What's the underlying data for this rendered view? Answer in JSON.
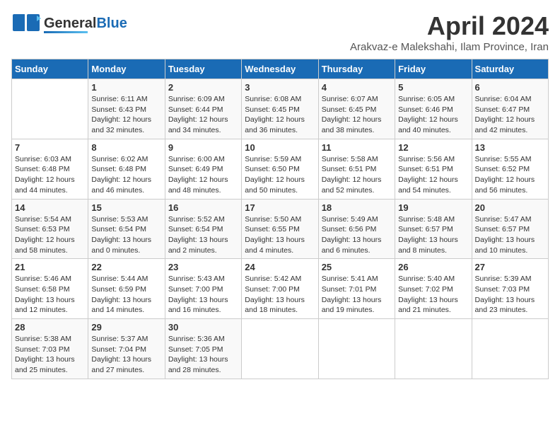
{
  "header": {
    "logo_general": "General",
    "logo_blue": "Blue",
    "month": "April 2024",
    "location": "Arakvaz-e Malekshahi, Ilam Province, Iran"
  },
  "days_of_week": [
    "Sunday",
    "Monday",
    "Tuesday",
    "Wednesday",
    "Thursday",
    "Friday",
    "Saturday"
  ],
  "weeks": [
    [
      {
        "day": "",
        "info": ""
      },
      {
        "day": "1",
        "info": "Sunrise: 6:11 AM\nSunset: 6:43 PM\nDaylight: 12 hours\nand 32 minutes."
      },
      {
        "day": "2",
        "info": "Sunrise: 6:09 AM\nSunset: 6:44 PM\nDaylight: 12 hours\nand 34 minutes."
      },
      {
        "day": "3",
        "info": "Sunrise: 6:08 AM\nSunset: 6:45 PM\nDaylight: 12 hours\nand 36 minutes."
      },
      {
        "day": "4",
        "info": "Sunrise: 6:07 AM\nSunset: 6:45 PM\nDaylight: 12 hours\nand 38 minutes."
      },
      {
        "day": "5",
        "info": "Sunrise: 6:05 AM\nSunset: 6:46 PM\nDaylight: 12 hours\nand 40 minutes."
      },
      {
        "day": "6",
        "info": "Sunrise: 6:04 AM\nSunset: 6:47 PM\nDaylight: 12 hours\nand 42 minutes."
      }
    ],
    [
      {
        "day": "7",
        "info": "Sunrise: 6:03 AM\nSunset: 6:48 PM\nDaylight: 12 hours\nand 44 minutes."
      },
      {
        "day": "8",
        "info": "Sunrise: 6:02 AM\nSunset: 6:48 PM\nDaylight: 12 hours\nand 46 minutes."
      },
      {
        "day": "9",
        "info": "Sunrise: 6:00 AM\nSunset: 6:49 PM\nDaylight: 12 hours\nand 48 minutes."
      },
      {
        "day": "10",
        "info": "Sunrise: 5:59 AM\nSunset: 6:50 PM\nDaylight: 12 hours\nand 50 minutes."
      },
      {
        "day": "11",
        "info": "Sunrise: 5:58 AM\nSunset: 6:51 PM\nDaylight: 12 hours\nand 52 minutes."
      },
      {
        "day": "12",
        "info": "Sunrise: 5:56 AM\nSunset: 6:51 PM\nDaylight: 12 hours\nand 54 minutes."
      },
      {
        "day": "13",
        "info": "Sunrise: 5:55 AM\nSunset: 6:52 PM\nDaylight: 12 hours\nand 56 minutes."
      }
    ],
    [
      {
        "day": "14",
        "info": "Sunrise: 5:54 AM\nSunset: 6:53 PM\nDaylight: 12 hours\nand 58 minutes."
      },
      {
        "day": "15",
        "info": "Sunrise: 5:53 AM\nSunset: 6:54 PM\nDaylight: 13 hours\nand 0 minutes."
      },
      {
        "day": "16",
        "info": "Sunrise: 5:52 AM\nSunset: 6:54 PM\nDaylight: 13 hours\nand 2 minutes."
      },
      {
        "day": "17",
        "info": "Sunrise: 5:50 AM\nSunset: 6:55 PM\nDaylight: 13 hours\nand 4 minutes."
      },
      {
        "day": "18",
        "info": "Sunrise: 5:49 AM\nSunset: 6:56 PM\nDaylight: 13 hours\nand 6 minutes."
      },
      {
        "day": "19",
        "info": "Sunrise: 5:48 AM\nSunset: 6:57 PM\nDaylight: 13 hours\nand 8 minutes."
      },
      {
        "day": "20",
        "info": "Sunrise: 5:47 AM\nSunset: 6:57 PM\nDaylight: 13 hours\nand 10 minutes."
      }
    ],
    [
      {
        "day": "21",
        "info": "Sunrise: 5:46 AM\nSunset: 6:58 PM\nDaylight: 13 hours\nand 12 minutes."
      },
      {
        "day": "22",
        "info": "Sunrise: 5:44 AM\nSunset: 6:59 PM\nDaylight: 13 hours\nand 14 minutes."
      },
      {
        "day": "23",
        "info": "Sunrise: 5:43 AM\nSunset: 7:00 PM\nDaylight: 13 hours\nand 16 minutes."
      },
      {
        "day": "24",
        "info": "Sunrise: 5:42 AM\nSunset: 7:00 PM\nDaylight: 13 hours\nand 18 minutes."
      },
      {
        "day": "25",
        "info": "Sunrise: 5:41 AM\nSunset: 7:01 PM\nDaylight: 13 hours\nand 19 minutes."
      },
      {
        "day": "26",
        "info": "Sunrise: 5:40 AM\nSunset: 7:02 PM\nDaylight: 13 hours\nand 21 minutes."
      },
      {
        "day": "27",
        "info": "Sunrise: 5:39 AM\nSunset: 7:03 PM\nDaylight: 13 hours\nand 23 minutes."
      }
    ],
    [
      {
        "day": "28",
        "info": "Sunrise: 5:38 AM\nSunset: 7:03 PM\nDaylight: 13 hours\nand 25 minutes."
      },
      {
        "day": "29",
        "info": "Sunrise: 5:37 AM\nSunset: 7:04 PM\nDaylight: 13 hours\nand 27 minutes."
      },
      {
        "day": "30",
        "info": "Sunrise: 5:36 AM\nSunset: 7:05 PM\nDaylight: 13 hours\nand 28 minutes."
      },
      {
        "day": "",
        "info": ""
      },
      {
        "day": "",
        "info": ""
      },
      {
        "day": "",
        "info": ""
      },
      {
        "day": "",
        "info": ""
      }
    ]
  ]
}
